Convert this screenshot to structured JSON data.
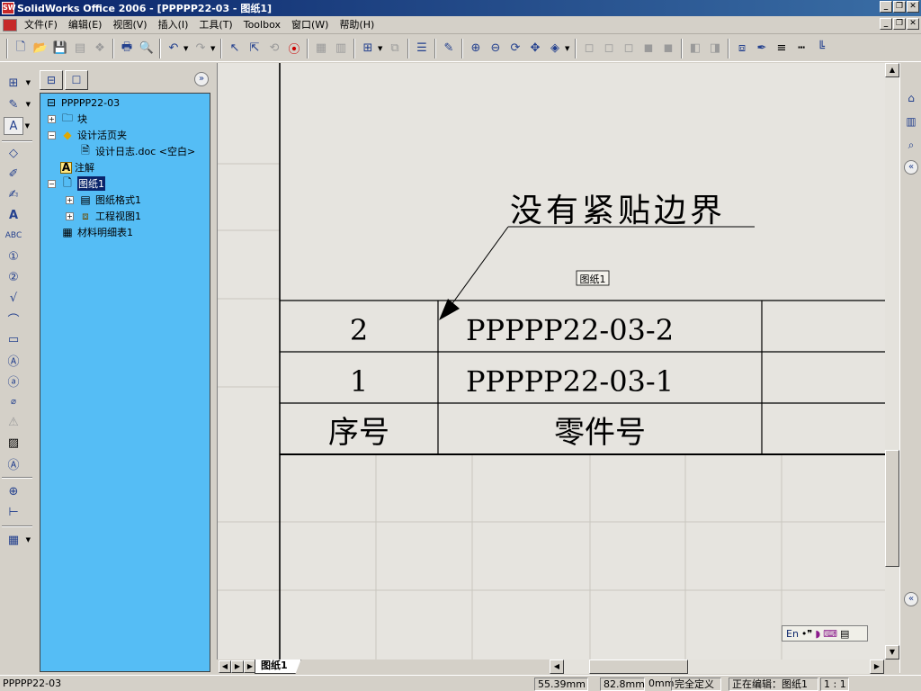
{
  "window": {
    "title": "SolidWorks Office 2006 - [PPPPP22-03 - 图纸1]",
    "min": "_",
    "restore": "❐",
    "close": "✕"
  },
  "menu": [
    "文件(F)",
    "编辑(E)",
    "视图(V)",
    "插入(I)",
    "工具(T)",
    "Toolbox",
    "窗口(W)",
    "帮助(H)"
  ],
  "tree": {
    "root": "PPPPP22-03",
    "blocks": "块",
    "design_binder": "设计活页夹",
    "design_log": "设计日志.doc <空白>",
    "annotations": "注解",
    "sheet": "图纸1",
    "sheet_format": "图纸格式1",
    "drawing_view": "工程视图1",
    "bom": "材料明细表1"
  },
  "drawing": {
    "note": "没有紧贴边界",
    "sheet_label": "图纸1",
    "bom_rows": [
      {
        "item": "2",
        "part": "PPPPP22-03-2"
      },
      {
        "item": "1",
        "part": "PPPPP22-03-1"
      }
    ],
    "bom_header": {
      "item": "序号",
      "part": "零件号"
    }
  },
  "sheet_tab": "图纸1",
  "ime": {
    "lang": "En"
  },
  "status": {
    "doc": "PPPPP22-03",
    "x": "55.39mm",
    "y": "82.8mm",
    "z": "0mm",
    "state": "完全定义",
    "editing": "正在编辑：图纸1",
    "scale": "1 : 1"
  },
  "colors": {
    "tree_bg": "#55bdf5",
    "canvas_bg": "#e6e4df",
    "title_bar": "#0a246a"
  }
}
